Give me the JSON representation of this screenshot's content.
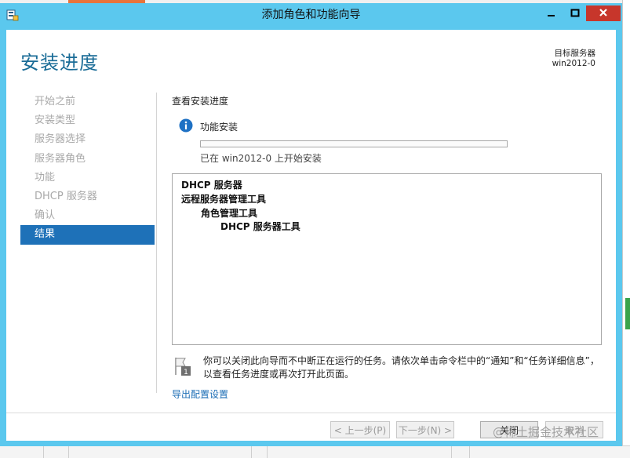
{
  "window": {
    "title": "添加角色和功能向导"
  },
  "header": {
    "page_title": "安装进度",
    "destination_label": "目标服务器",
    "destination_server": "win2012-0"
  },
  "nav": {
    "items": [
      {
        "label": "开始之前",
        "active": false
      },
      {
        "label": "安装类型",
        "active": false
      },
      {
        "label": "服务器选择",
        "active": false
      },
      {
        "label": "服务器角色",
        "active": false
      },
      {
        "label": "功能",
        "active": false
      },
      {
        "label": "DHCP 服务器",
        "active": false
      },
      {
        "label": "确认",
        "active": false
      },
      {
        "label": "结果",
        "active": true
      }
    ]
  },
  "main": {
    "section_label": "查看安装进度",
    "feature_install_label": "功能安装",
    "progress": 0.0,
    "status_text": "已在 win2012-0 上开始安装",
    "results": [
      {
        "text": "DHCP 服务器",
        "level": 0
      },
      {
        "text": "远程服务器管理工具",
        "level": 0
      },
      {
        "text": "角色管理工具",
        "level": 1
      },
      {
        "text": "DHCP 服务器工具",
        "level": 2
      }
    ],
    "note": "你可以关闭此向导而不中断正在运行的任务。请依次单击命令栏中的“通知”和“任务详细信息”，以查看任务进度或再次打开此页面。",
    "export_link": "导出配置设置"
  },
  "footer": {
    "prev_label": "< 上一步(P)",
    "next_label": "下一步(N) >",
    "close_label": "关闭",
    "cancel_label": "取消"
  },
  "watermark": "@稀土掘金技术社区",
  "colors": {
    "title_bar": "#5bc8ee",
    "accent": "#1a6c97",
    "nav_active": "#1e71b8",
    "close_button": "#c7362b"
  }
}
